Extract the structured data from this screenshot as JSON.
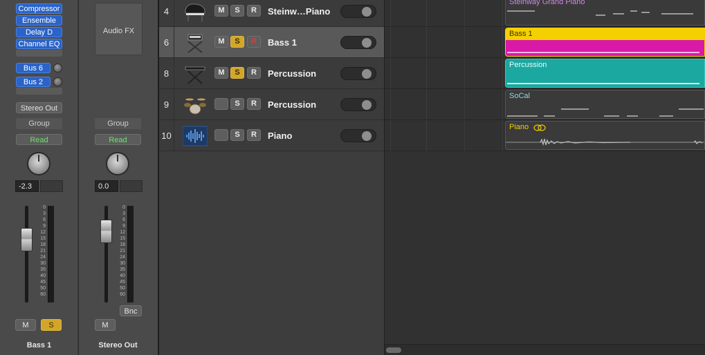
{
  "mixer": {
    "strip1": {
      "plugins": [
        "Compressor",
        "Ensemble",
        "Delay D",
        "Channel EQ"
      ],
      "sends": [
        "Bus 6",
        "Bus 2"
      ],
      "output": "Stereo Out",
      "group": "Group",
      "automation": "Read",
      "volume": "-2.3",
      "mute_label": "M",
      "solo_label": "S",
      "solo_active": true,
      "name": "Bass 1"
    },
    "strip2": {
      "audio_fx_label": "Audio FX",
      "group": "Group",
      "automation": "Read",
      "volume": "0.0",
      "mute_label": "M",
      "bounce_label": "Bnc",
      "name": "Stereo Out"
    },
    "scale": [
      "0",
      "3",
      "6",
      "9",
      "12",
      "15",
      "18",
      "21",
      "24",
      "30",
      "35",
      "40",
      "45",
      "50",
      "60"
    ]
  },
  "tracks": [
    {
      "number": "4",
      "icon": "grand-piano-icon",
      "mute": "M",
      "solo": "S",
      "record": "R",
      "name": "Steinw…Piano",
      "solo_on": false,
      "selected": false
    },
    {
      "number": "6",
      "icon": "keyboard-stand-icon",
      "mute": "M",
      "solo": "S",
      "record": "R",
      "name": "Bass 1",
      "solo_on": true,
      "selected": true
    },
    {
      "number": "8",
      "icon": "keyboard-stand-icon",
      "mute": "M",
      "solo": "S",
      "record": "R",
      "name": "Percussion",
      "solo_on": true,
      "selected": false
    },
    {
      "number": "9",
      "icon": "drum-kit-icon",
      "mute": "",
      "solo": "S",
      "record": "R",
      "name": "Percussion",
      "solo_on": false,
      "selected": false
    },
    {
      "number": "10",
      "icon": "audio-waveform-icon",
      "mute": "",
      "solo": "S",
      "record": "R",
      "name": "Piano",
      "solo_on": false,
      "selected": false
    }
  ],
  "regions": [
    {
      "name": "Steinway Grand Piano",
      "color": "#3b3b3b",
      "title_color": "#c98be0"
    },
    {
      "name": "Bass 1",
      "color": "#d91aa8",
      "header_color": "#f5d000",
      "title_color": "#3a2f00"
    },
    {
      "name": "Percussion",
      "color": "#1ba8a0",
      "title_color": "#e8ffff"
    },
    {
      "name": "SoCal",
      "color": "#3b3b3b",
      "title_color": "#8fd8f0"
    },
    {
      "name": "Piano",
      "color": "#3b3b3b",
      "title_color": "#f5d000"
    }
  ]
}
